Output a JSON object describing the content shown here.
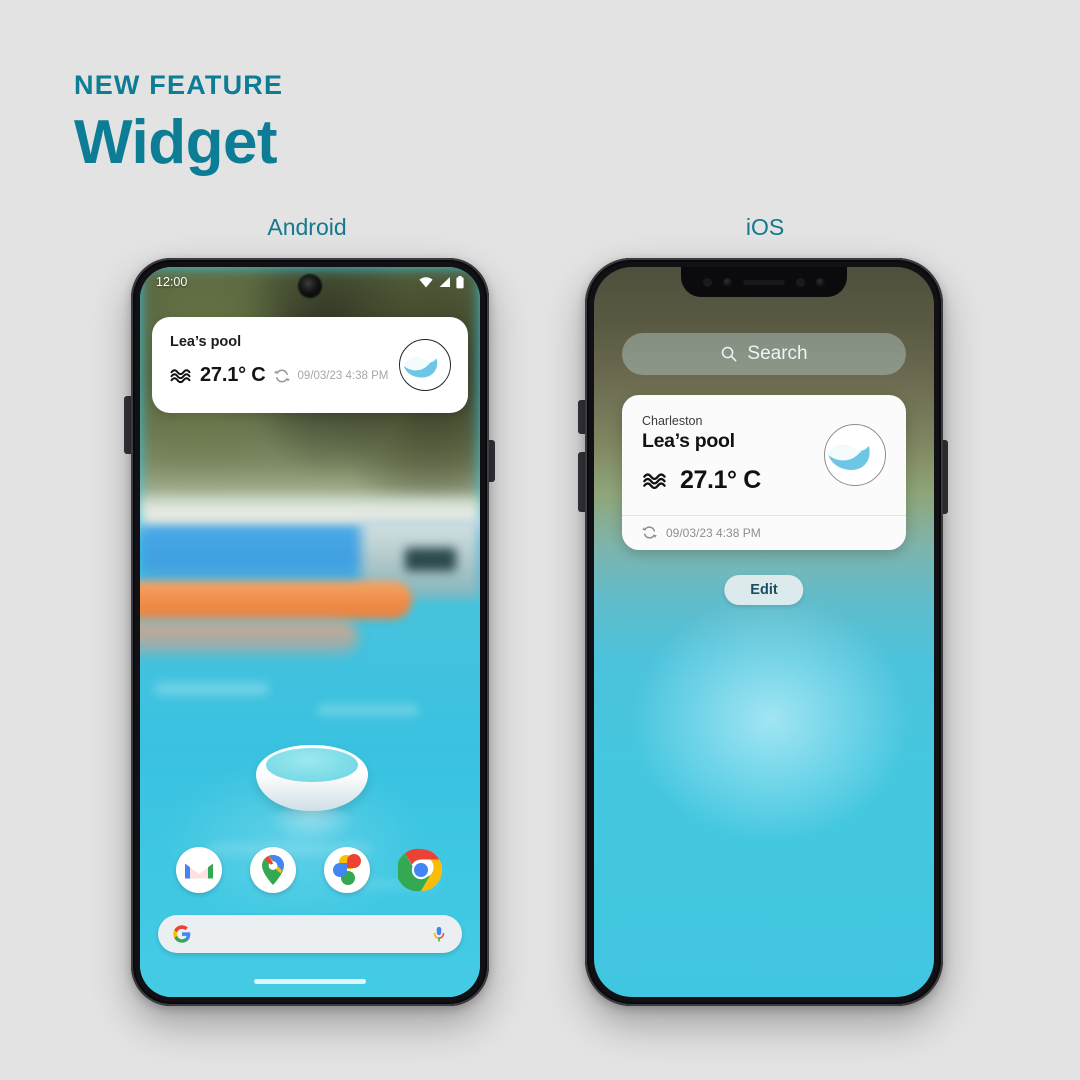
{
  "headline": {
    "kicker": "NEW FEATURE",
    "title": "Widget",
    "accent_color": "#0d7d96"
  },
  "platform_labels": {
    "android": "Android",
    "ios": "iOS",
    "color": "#15788d"
  },
  "background_color": "#e3e3e3",
  "android": {
    "status_bar": {
      "time": "12:00",
      "icons": [
        "wifi-icon",
        "cellular-signal-icon",
        "battery-icon"
      ]
    },
    "widget": {
      "pool_name": "Lea’s pool",
      "temperature": "27.1° C",
      "timestamp": "09/03/23 4:38 PM",
      "wave_icon": "water-wave-icon",
      "refresh_icon": "refresh-icon",
      "logo_icon": "pool-wave-logo-icon",
      "background_color": "#ffffff"
    },
    "dock": {
      "apps": [
        {
          "name": "gmail-icon",
          "label": "Gmail"
        },
        {
          "name": "google-maps-icon",
          "label": "Maps"
        },
        {
          "name": "google-photos-icon",
          "label": "Photos"
        },
        {
          "name": "chrome-icon",
          "label": "Chrome"
        }
      ]
    },
    "search_bar": {
      "google_icon": "google-g-icon",
      "mic_icon": "microphone-icon",
      "value": "",
      "placeholder": ""
    },
    "wallpaper": "pool-photo-wallpaper",
    "home_indicator": "home-indicator"
  },
  "ios": {
    "search": {
      "placeholder": "Search",
      "icon": "search-icon"
    },
    "widget": {
      "city": "Charleston",
      "pool_name": "Lea’s pool",
      "temperature": "27.1° C",
      "timestamp": "09/03/23 4:38 PM",
      "wave_icon": "water-wave-icon",
      "refresh_icon": "refresh-icon",
      "logo_icon": "pool-wave-logo-icon",
      "background_color": "#fbfbfb"
    },
    "edit_button": {
      "label": "Edit"
    },
    "wallpaper": "blurred-pool-gradient-wallpaper"
  },
  "brand": {
    "wave_blue": "#6ec6e5",
    "teal": "#0d7d96"
  }
}
